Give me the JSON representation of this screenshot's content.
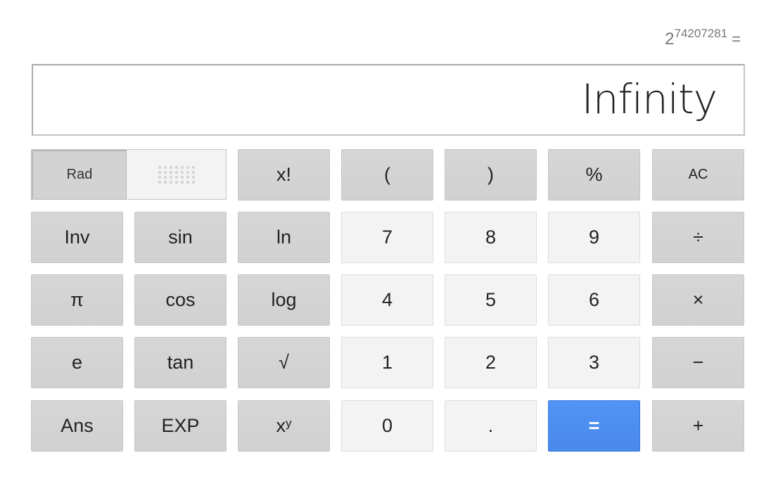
{
  "history": {
    "base": "2",
    "exponent": "74207281",
    "equals": "="
  },
  "display": {
    "value": "Infinity"
  },
  "mode_toggle": {
    "active": "Rad",
    "inactive_label": ""
  },
  "buttons": {
    "factorial": "x!",
    "open_paren": "(",
    "close_paren": ")",
    "percent": "%",
    "clear": "AC",
    "inv": "Inv",
    "sin": "sin",
    "ln": "ln",
    "seven": "7",
    "eight": "8",
    "nine": "9",
    "divide": "÷",
    "pi": "π",
    "cos": "cos",
    "log": "log",
    "four": "4",
    "five": "5",
    "six": "6",
    "multiply": "×",
    "e": "e",
    "tan": "tan",
    "sqrt": "√",
    "one": "1",
    "two": "2",
    "three": "3",
    "minus": "−",
    "ans": "Ans",
    "exp": "EXP",
    "power_base": "x",
    "power_exp": "y",
    "zero": "0",
    "decimal": ".",
    "equals": "=",
    "plus": "+"
  },
  "colors": {
    "equals_button": "#4d8ff0",
    "function_button": "#d4d4d4",
    "digit_button": "#f3f3f3"
  }
}
